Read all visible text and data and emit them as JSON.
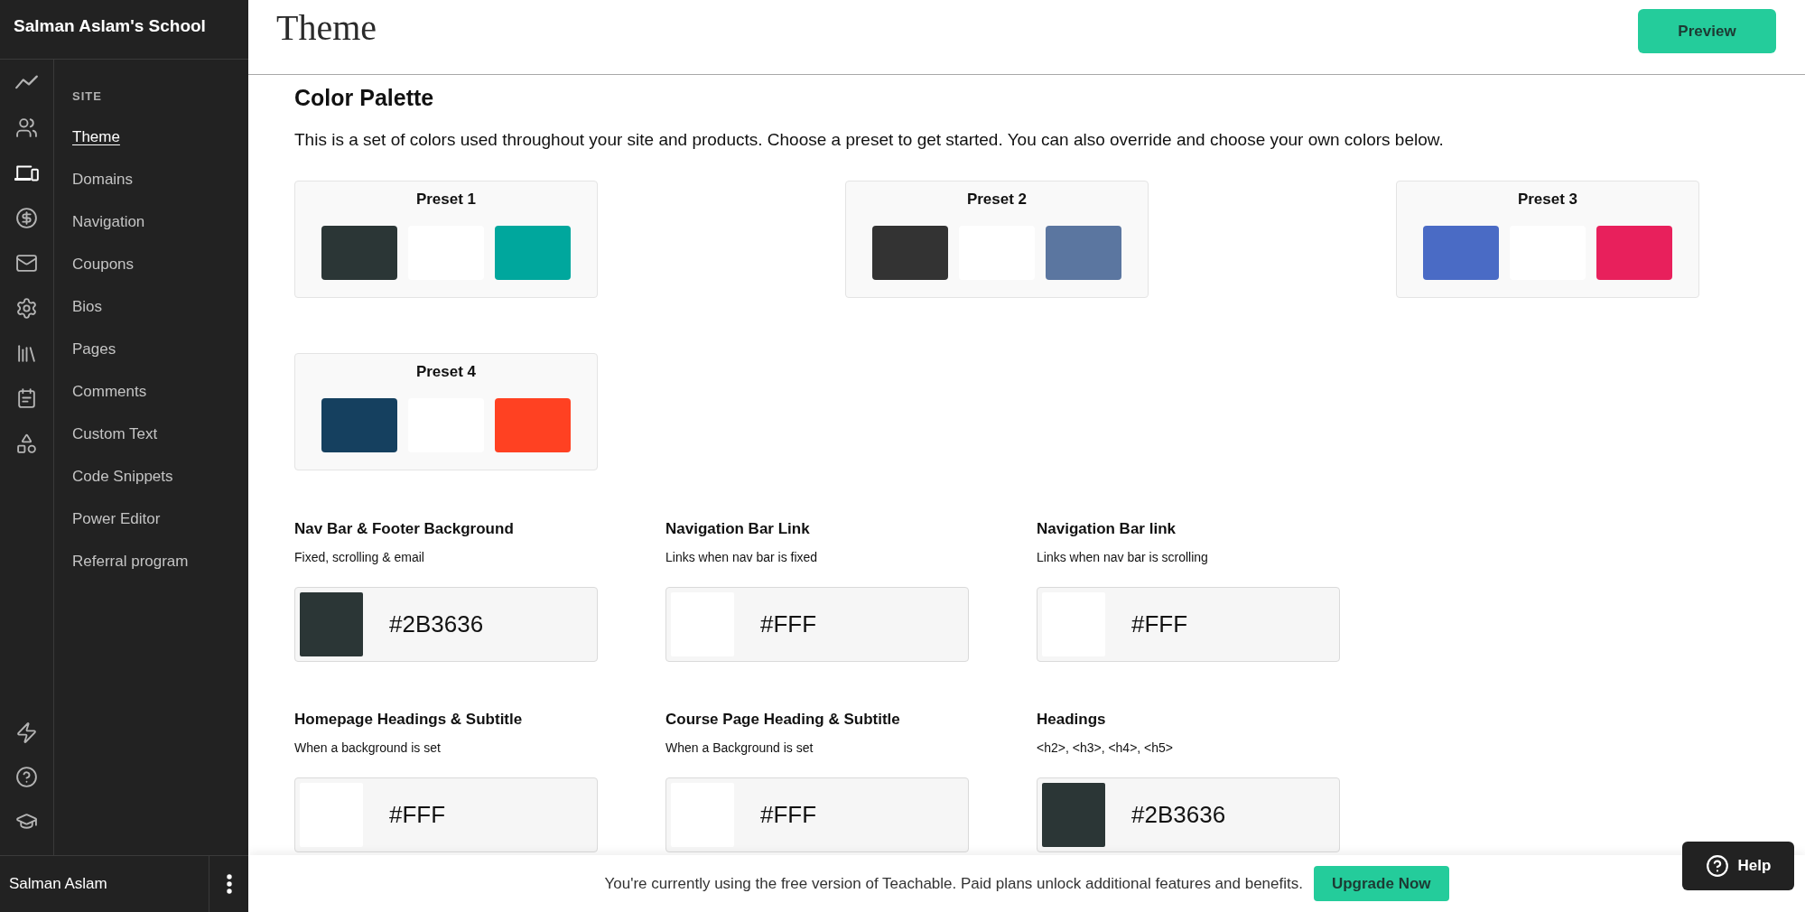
{
  "sidebar": {
    "school_name": "Salman Aslam's School",
    "rail": [
      {
        "selected": false
      },
      {
        "selected": false
      },
      {
        "selected": true
      },
      {
        "selected": false
      },
      {
        "selected": false
      },
      {
        "selected": false
      },
      {
        "selected": false
      },
      {
        "selected": false
      },
      {
        "selected": false
      }
    ],
    "section_title": "SITE",
    "nav": [
      {
        "label": "Theme",
        "selected": true
      },
      {
        "label": "Domains",
        "selected": false
      },
      {
        "label": "Navigation",
        "selected": false
      },
      {
        "label": "Coupons",
        "selected": false
      },
      {
        "label": "Bios",
        "selected": false
      },
      {
        "label": "Pages",
        "selected": false
      },
      {
        "label": "Comments",
        "selected": false
      },
      {
        "label": "Custom Text",
        "selected": false
      },
      {
        "label": "Code Snippets",
        "selected": false
      },
      {
        "label": "Power Editor",
        "selected": false
      },
      {
        "label": "Referral program",
        "selected": false
      }
    ],
    "user_name": "Salman Aslam"
  },
  "header": {
    "title": "Theme",
    "preview_button": "Preview"
  },
  "palette": {
    "title": "Color Palette",
    "description": "This is a set of colors used throughout your site and products. Choose a preset to get started. You can also override and choose your own colors below.",
    "presets": [
      {
        "label": "Preset 1",
        "swatches": [
          {
            "color": "#2b3636"
          },
          {
            "color": "#ffffff"
          },
          {
            "color": "#00a79d"
          }
        ]
      },
      {
        "label": "Preset 2",
        "swatches": [
          {
            "color": "#333333"
          },
          {
            "color": "#ffffff"
          },
          {
            "color": "#5b76a0"
          }
        ]
      },
      {
        "label": "Preset 3",
        "swatches": [
          {
            "color": "#4a6bc5"
          },
          {
            "color": "#ffffff"
          },
          {
            "color": "#e8205c"
          }
        ]
      },
      {
        "label": "Preset 4",
        "swatches": [
          {
            "color": "#15405f"
          },
          {
            "color": "#ffffff"
          },
          {
            "color": "#ff4122"
          }
        ]
      }
    ]
  },
  "color_settings": [
    {
      "label": "Nav Bar & Footer Background",
      "hint": "Fixed, scrolling & email",
      "value": "#2B3636",
      "color": "#2b3636"
    },
    {
      "label": "Navigation Bar Link",
      "hint": "Links when nav bar is fixed",
      "value": "#FFF",
      "color": "#ffffff"
    },
    {
      "label": "Navigation Bar link",
      "hint": "Links when nav bar is scrolling",
      "value": "#FFF",
      "color": "#ffffff"
    },
    {
      "label": "Homepage Headings & Subtitle",
      "hint": "When a background is set",
      "value": "#FFF",
      "color": "#ffffff"
    },
    {
      "label": "Course Page Heading & Subtitle",
      "hint": "When a Background is set",
      "value": "#FFF",
      "color": "#ffffff"
    },
    {
      "label": "Headings",
      "hint": "<h2>, <h3>, <h4>, <h5>",
      "value": "#2B3636",
      "color": "#2b3636"
    }
  ],
  "banner": {
    "text": "You're currently using the free version of Teachable. Paid plans unlock additional features and benefits.",
    "button": "Upgrade Now"
  },
  "help_button": "Help"
}
